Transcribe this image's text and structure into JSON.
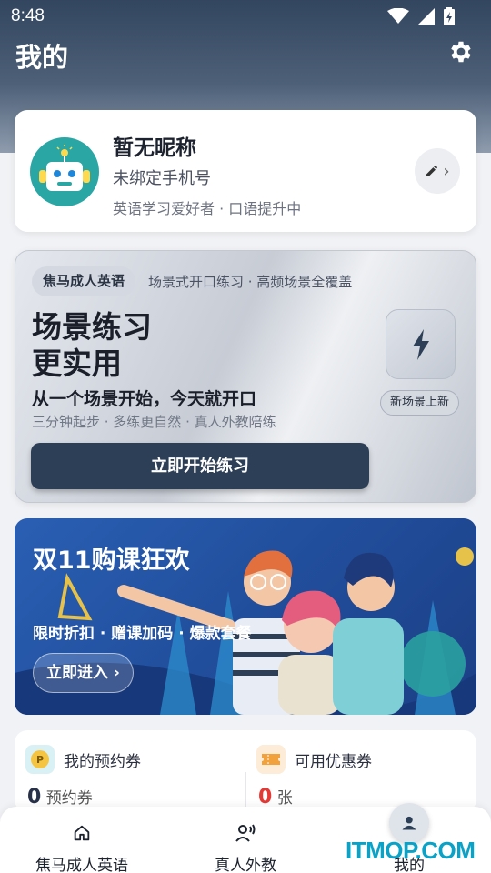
{
  "status": {
    "time": "8:48"
  },
  "header": {
    "title": "我的"
  },
  "profile": {
    "nickname": "暂无昵称",
    "phone": "未绑定手机号",
    "tagline": "英语学习爱好者 · 口语提升中",
    "edit_chevron": "›"
  },
  "promo": {
    "brand": "焦马成人英语",
    "subtitle": "场景式开口练习 · 高频场景全覆盖",
    "headline_1": "场景练习",
    "headline_2": "更实用",
    "line2": "从一个场景开始，今天就开口",
    "line3": "三分钟起步 · 多练更自然 · 真人外教陪练",
    "button": "立即开始练习",
    "badge": "新场景上新"
  },
  "banner": {
    "title": "双11购课狂欢",
    "subtitle": "限时折扣 · 赠课加码 · 爆款套餐",
    "button": "立即进入 ›"
  },
  "coupons": {
    "left": {
      "label": "我的预约券",
      "value": "0",
      "unit": "预约券",
      "color": "#27324a",
      "icon": "p-coin-icon"
    },
    "right": {
      "label": "可用优惠券",
      "value": "0",
      "unit": "张",
      "color": "#e53935",
      "icon": "ticket-icon"
    }
  },
  "tabbar": {
    "tabs": [
      {
        "label": "焦马成人英语",
        "icon": "home-icon"
      },
      {
        "label": "真人外教",
        "icon": "speaker-person-icon"
      },
      {
        "label": "我的",
        "icon": "person-icon"
      }
    ]
  },
  "watermark": "ITMOP.COM",
  "colors": {
    "header": "#33465f",
    "primary_button": "#2d3f56",
    "banner": "#2a5fb3",
    "accent_red": "#e53935",
    "watermark": "#0aa2c7"
  }
}
